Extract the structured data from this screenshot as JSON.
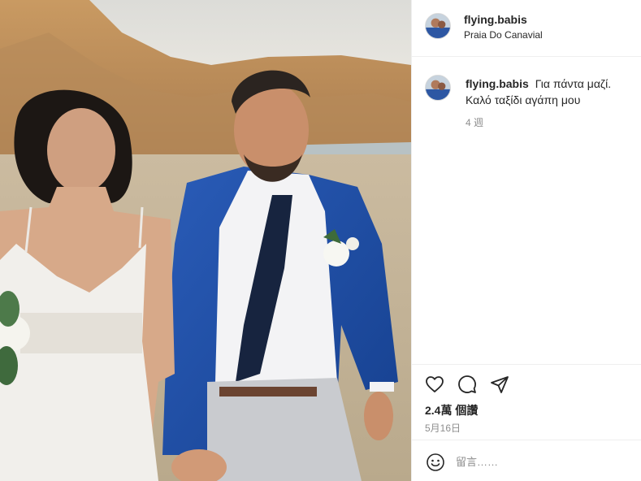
{
  "post": {
    "username": "flying.babis",
    "location": "Praia Do Canavial",
    "caption": "Για πάντα μαζί. Καλό ταξίδι αγάπη μου",
    "caption_time": "4 週",
    "likes": "2.4萬 個讚",
    "date": "5月16日",
    "photo_alt": "wedding photo"
  },
  "actions": {
    "like_icon": "heart-icon",
    "comment_icon": "comment-bubble-icon",
    "share_icon": "paper-plane-icon"
  },
  "comment_box": {
    "emoji_icon": "smiley-icon",
    "placeholder": "留言……"
  },
  "colors": {
    "text": "#262626",
    "muted": "#8e8e8e",
    "border": "#efefef",
    "suit_blue": "#1f4fa8"
  }
}
